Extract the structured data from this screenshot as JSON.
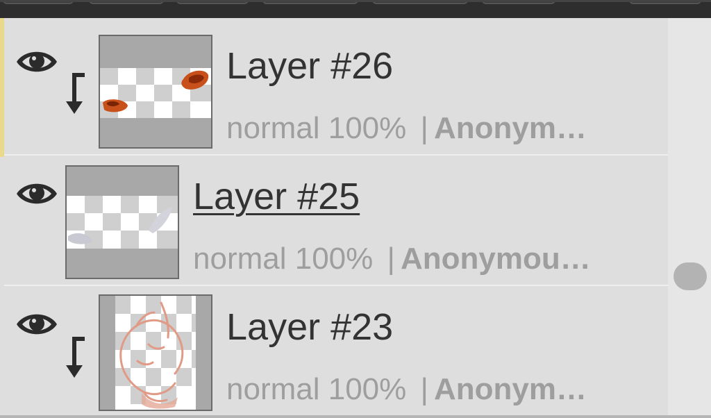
{
  "layers_panel": {
    "layers": [
      {
        "name": "Layer #26",
        "blend": "normal",
        "opacity": "100%",
        "separator": "|",
        "owner": "Anonym…",
        "clipped": true,
        "active": false,
        "visible_icon": "eye-icon",
        "clip_icon": "clipping-arrow-icon"
      },
      {
        "name": "Layer #25",
        "blend": "normal",
        "opacity": "100%",
        "separator": "|",
        "owner": "Anonymou…",
        "clipped": false,
        "active": true,
        "visible_icon": "eye-icon"
      },
      {
        "name": "Layer #23",
        "blend": "normal",
        "opacity": "100%",
        "separator": "|",
        "owner": "Anonym…",
        "clipped": true,
        "active": false,
        "visible_icon": "eye-icon",
        "clip_icon": "clipping-arrow-icon"
      }
    ]
  },
  "colors": {
    "panel_bg": "#dedede",
    "toolbar_bg": "#2e2e2e",
    "accent": "#e9d98a",
    "text": "#333333",
    "meta_text": "#9e9e9e",
    "stroke_orange": "#d4511c"
  }
}
